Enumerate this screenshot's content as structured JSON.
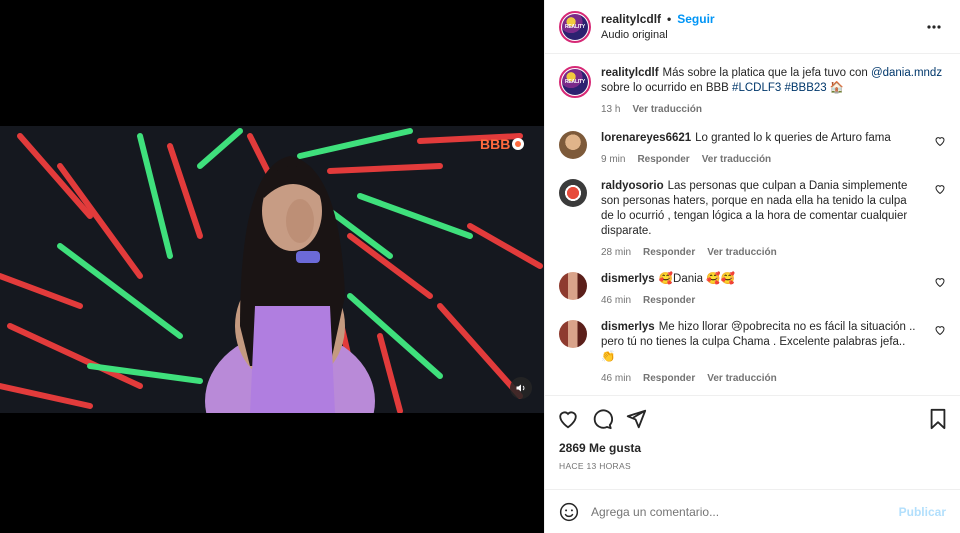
{
  "post": {
    "username": "realitylcdlf",
    "follow_label": "Seguir",
    "separator": "•",
    "audio_label": "Audio original",
    "avatar_text": "REALITY",
    "video_badge": "BBB"
  },
  "caption": {
    "username": "realitylcdlf",
    "text_before_mention": "Más sobre la platica que la jefa tuvo con ",
    "mention": "@dania.mndz",
    "text_after_mention": " sobre lo ocurrido en BBB ",
    "tag1": "#LCDLF3",
    "tag2": "#BBB23",
    "emoji": "🏠",
    "time": "13 h",
    "translate_label": "Ver traducción"
  },
  "comments": [
    {
      "username": "lorenareyes6621",
      "text": "Lo granted lo k queries de Arturo fama",
      "time": "9 min",
      "reply": "Responder",
      "translate": "Ver traducción",
      "avatar_color": "#b58a5e"
    },
    {
      "username": "raldyosorio",
      "text": "Las personas que culpan a Dania simplemente son personas haters, porque en nada ella ha tenido la culpa de lo ocurrió , tengan lógica a la hora de comentar cualquier disparate.",
      "time": "28 min",
      "reply": "Responder",
      "translate": "Ver traducción",
      "avatar_color": "#c0392b"
    },
    {
      "username": "dismerlys",
      "text": "🥰Dania 🥰🥰",
      "time": "46 min",
      "reply": "Responder",
      "translate": "",
      "avatar_color": "#8e3b2f"
    },
    {
      "username": "dismerlys",
      "text": "Me hizo llorar 😢pobrecita no es fácil la situación .. pero tú no tienes la culpa Chama . Excelente palabras jefa.. 👏",
      "time": "46 min",
      "reply": "Responder",
      "translate": "Ver traducción",
      "avatar_color": "#8e3b2f"
    }
  ],
  "likes": "2869 Me gusta",
  "posted_ago": "HACE 13 HORAS",
  "comment_box": {
    "placeholder": "Agrega un comentario...",
    "publish_label": "Publicar"
  },
  "icons": {
    "more": "more-options-icon",
    "like": "heart-icon",
    "comment": "comment-icon",
    "share": "share-icon",
    "save": "bookmark-icon",
    "emoji": "emoji-icon",
    "mute": "speaker-icon"
  },
  "colors": {
    "link": "#0095f6",
    "mention": "#00376b",
    "secondary_text": "#737373"
  }
}
